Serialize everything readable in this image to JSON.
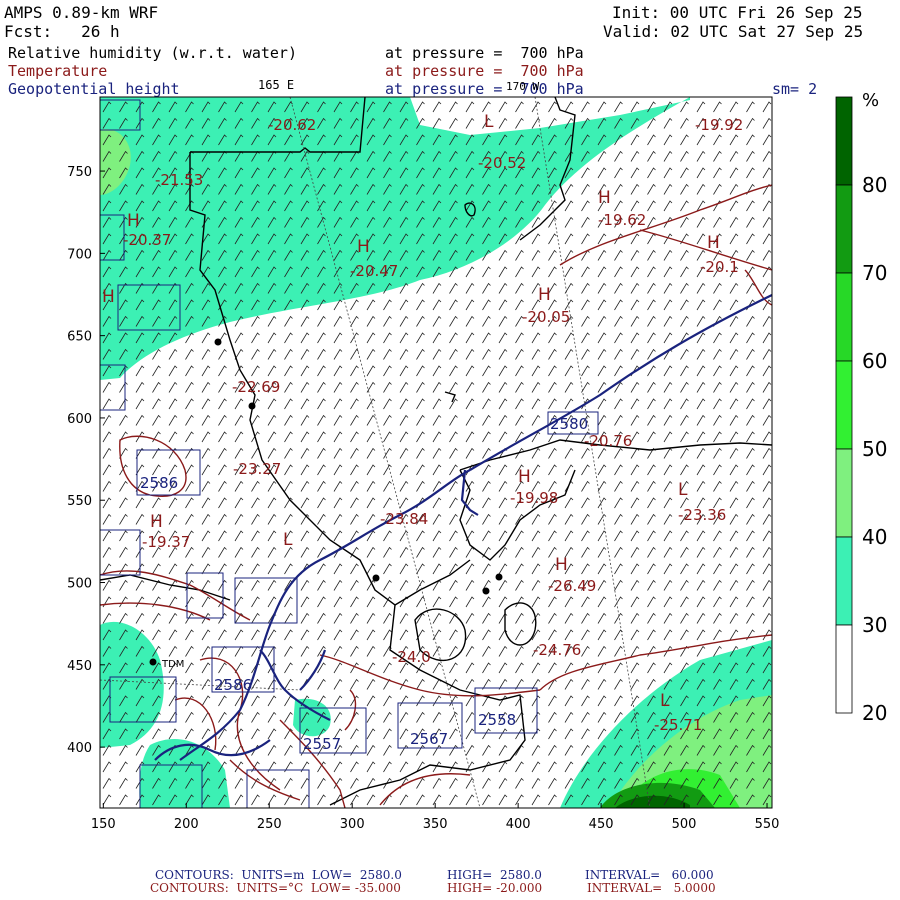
{
  "header": {
    "model": "AMPS 0.89-km WRF",
    "fcst": "Fcst:   26 h",
    "init": "Init: 00 UTC Fri 26 Sep 25",
    "valid": "Valid: 02 UTC Sat 27 Sep 25",
    "field1": "Relative humidity (w.r.t. water)",
    "field2": "Temperature",
    "field3": "Geopotential height",
    "level1": "at pressure =  700 hPa",
    "level2": "at pressure =  700 hPa",
    "level3": "at pressure =  700 hPa",
    "lon_label_left": "165 E",
    "lon_label_right": "170 W",
    "smoothing": "sm= 2"
  },
  "colorbar": {
    "unit": "%",
    "levels": [
      "80",
      "70",
      "60",
      "50",
      "40",
      "30",
      "20"
    ],
    "colors": [
      "#006400",
      "#129b12",
      "#27d827",
      "#32f032",
      "#7ff07f",
      "#3cf0b4",
      "#ffffff"
    ]
  },
  "axes": {
    "x_ticks": [
      "150",
      "200",
      "250",
      "300",
      "350",
      "400",
      "450",
      "500",
      "550"
    ],
    "y_ticks": [
      "750",
      "700",
      "650",
      "600",
      "550",
      "500",
      "450",
      "400"
    ],
    "x_range": [
      148,
      553
    ],
    "y_range": [
      363,
      795
    ]
  },
  "map_labels": {
    "red_values": [
      "-20.62",
      "-19.92",
      "-21.53",
      "-20.37",
      "-20.47",
      "-19.62",
      "-20.52",
      "-20.05",
      "-20.1",
      "-22.69",
      "-23.27",
      "-20.76",
      "-19.98",
      "-23.84",
      "-23.36",
      "-19.37",
      "-26.49",
      "-24.76",
      "-25.71",
      "-24.0"
    ],
    "blue_values": [
      "2580",
      "2586",
      "2584",
      "2557",
      "2558",
      "2567"
    ],
    "station": "TDM",
    "hl": [
      "H",
      "L"
    ]
  },
  "footer": {
    "line1_label": "CONTOURS:  UNITS=m  LOW=  2580.0",
    "line1_high": "HIGH=  2580.0",
    "line1_interval": "INTERVAL=   60.000",
    "line2_label": "CONTOURS:  UNITS=°C  LOW= -35.000",
    "line2_high": "HIGH= -20.000",
    "line2_interval": "INTERVAL=   5.0000"
  }
}
